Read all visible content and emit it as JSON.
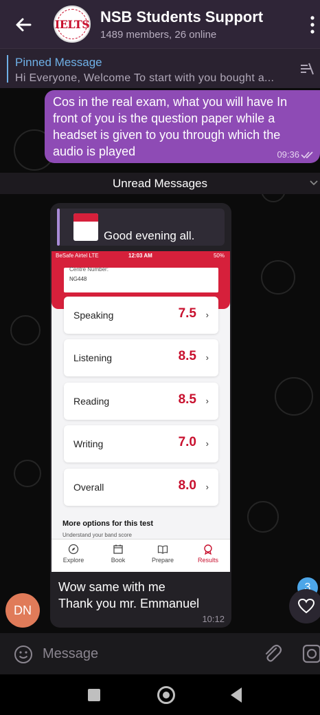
{
  "header": {
    "title": "NSB Students Support",
    "subtitle": "1489 members, 26 online",
    "avatar_logo_text": "IELTS"
  },
  "pinned": {
    "title": "Pinned Message",
    "text": "Hi Everyone,   Welcome   To start with you bought a..."
  },
  "outgoing": {
    "text": "Cos in the real exam, what you will have In front of you is the question paper while a headset is given to you through which the audio is played",
    "time": "09:36"
  },
  "unread_label": "Unread Messages",
  "incoming": {
    "reply_text": "Good evening all.",
    "text_line1": "Wow same with me",
    "text_line2": "Thank you mr. Emmanuel",
    "time": "10:12",
    "screenshot": {
      "status_left": "BeSafe Airtel  LTE",
      "status_center": "12:03 AM",
      "status_right": "50%",
      "centre_label": "Centre Number:",
      "centre_value": "NG448",
      "scores": [
        {
          "label": "Speaking",
          "value": "7.5"
        },
        {
          "label": "Listening",
          "value": "8.5"
        },
        {
          "label": "Reading",
          "value": "8.5"
        },
        {
          "label": "Writing",
          "value": "7.0"
        },
        {
          "label": "Overall",
          "value": "8.0"
        }
      ],
      "more_options": "More options for this test",
      "more_sub": "Understand your band score",
      "tabs": [
        "Explore",
        "Book",
        "Prepare",
        "Results"
      ]
    }
  },
  "sender_initials": "DN",
  "unread_count": "3",
  "input": {
    "placeholder": "Message"
  },
  "colors": {
    "header_bg": "#2f2537",
    "outgoing_bubble": "#8e4bb5",
    "incoming_bubble": "#232126",
    "accent_blue": "#6fb0e6",
    "results_red": "#c8102e",
    "avatar_orange": "#e07b59"
  }
}
